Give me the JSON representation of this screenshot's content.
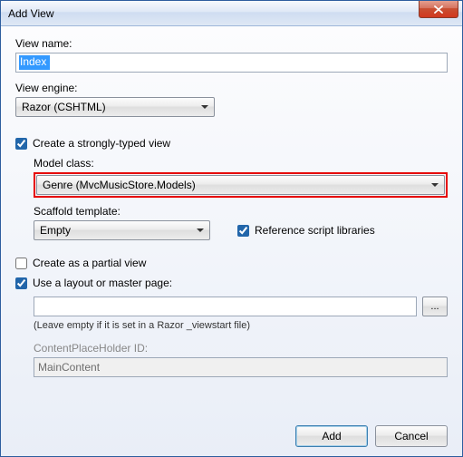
{
  "titlebar": {
    "title": "Add View"
  },
  "viewName": {
    "label": "View name:",
    "value": "Index"
  },
  "viewEngine": {
    "label": "View engine:",
    "value": "Razor (CSHTML)"
  },
  "stronglyTyped": {
    "label": "Create a strongly-typed view",
    "checked": true
  },
  "modelClass": {
    "label": "Model class:",
    "value": "Genre (MvcMusicStore.Models)"
  },
  "scaffold": {
    "label": "Scaffold template:",
    "value": "Empty"
  },
  "refScripts": {
    "label": "Reference script libraries",
    "checked": true
  },
  "partial": {
    "label": "Create as a partial view",
    "checked": false
  },
  "useLayout": {
    "label": "Use a layout or master page:",
    "checked": true
  },
  "layoutPath": {
    "value": ""
  },
  "layoutHint": "(Leave empty if it is set in a Razor _viewstart file)",
  "cph": {
    "label": "ContentPlaceHolder ID:",
    "value": "MainContent"
  },
  "buttons": {
    "add": "Add",
    "cancel": "Cancel",
    "browse": "..."
  }
}
